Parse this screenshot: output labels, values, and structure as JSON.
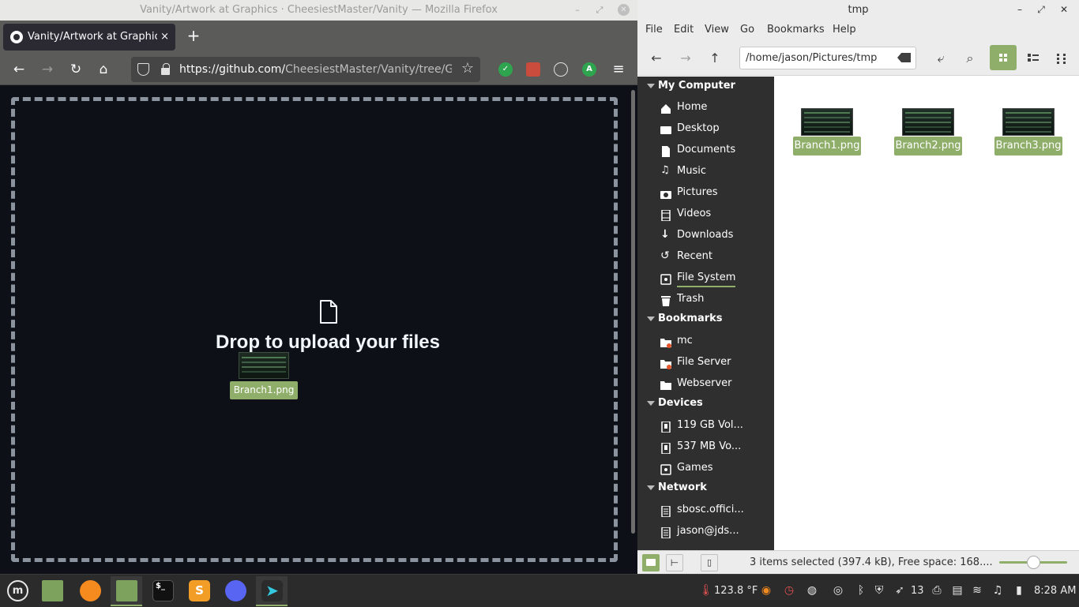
{
  "firefox": {
    "window_title": "Vanity/Artwork at Graphics · CheesiestMaster/Vanity — Mozilla Firefox",
    "tab_title": "Vanity/Artwork at Graphics",
    "tab_close": "×",
    "new_tab": "+",
    "url_host": "https://github.com/",
    "url_path": "CheesiestMaster/Vanity/tree/Grap",
    "extension_avatar": "A",
    "drop_text": "Drop to upload your files",
    "drag_label": "Branch1.png"
  },
  "nemo": {
    "window_title": "tmp",
    "menu": [
      "File",
      "Edit",
      "View",
      "Go",
      "Bookmarks",
      "Help"
    ],
    "path": "/home/jason/Pictures/tmp",
    "sidebar": {
      "my_computer": "My Computer",
      "computer_items": [
        "Home",
        "Desktop",
        "Documents",
        "Music",
        "Pictures",
        "Videos",
        "Downloads",
        "Recent",
        "File System",
        "Trash"
      ],
      "bookmarks": "Bookmarks",
      "bookmark_items": [
        "mc",
        "File Server",
        "Webserver"
      ],
      "devices": "Devices",
      "device_items": [
        "119 GB Vol...",
        "537 MB Vo...",
        "Games"
      ],
      "network": "Network",
      "network_items": [
        "sbosc.offici...",
        "jason@jds..."
      ]
    },
    "files": [
      "Branch1.png",
      "Branch2.png",
      "Branch3.png"
    ],
    "status": "3 items selected (397.4 kB), Free space: 168....",
    "zoom_level": 0.5
  },
  "panel": {
    "temperature": "123.8 °F",
    "notifications_count": "13",
    "clock": "8:28 AM"
  },
  "colors": {
    "accent": "#8fae6a",
    "github_bg": "#0d1117",
    "sidebar_bg": "#2f2f2f"
  }
}
